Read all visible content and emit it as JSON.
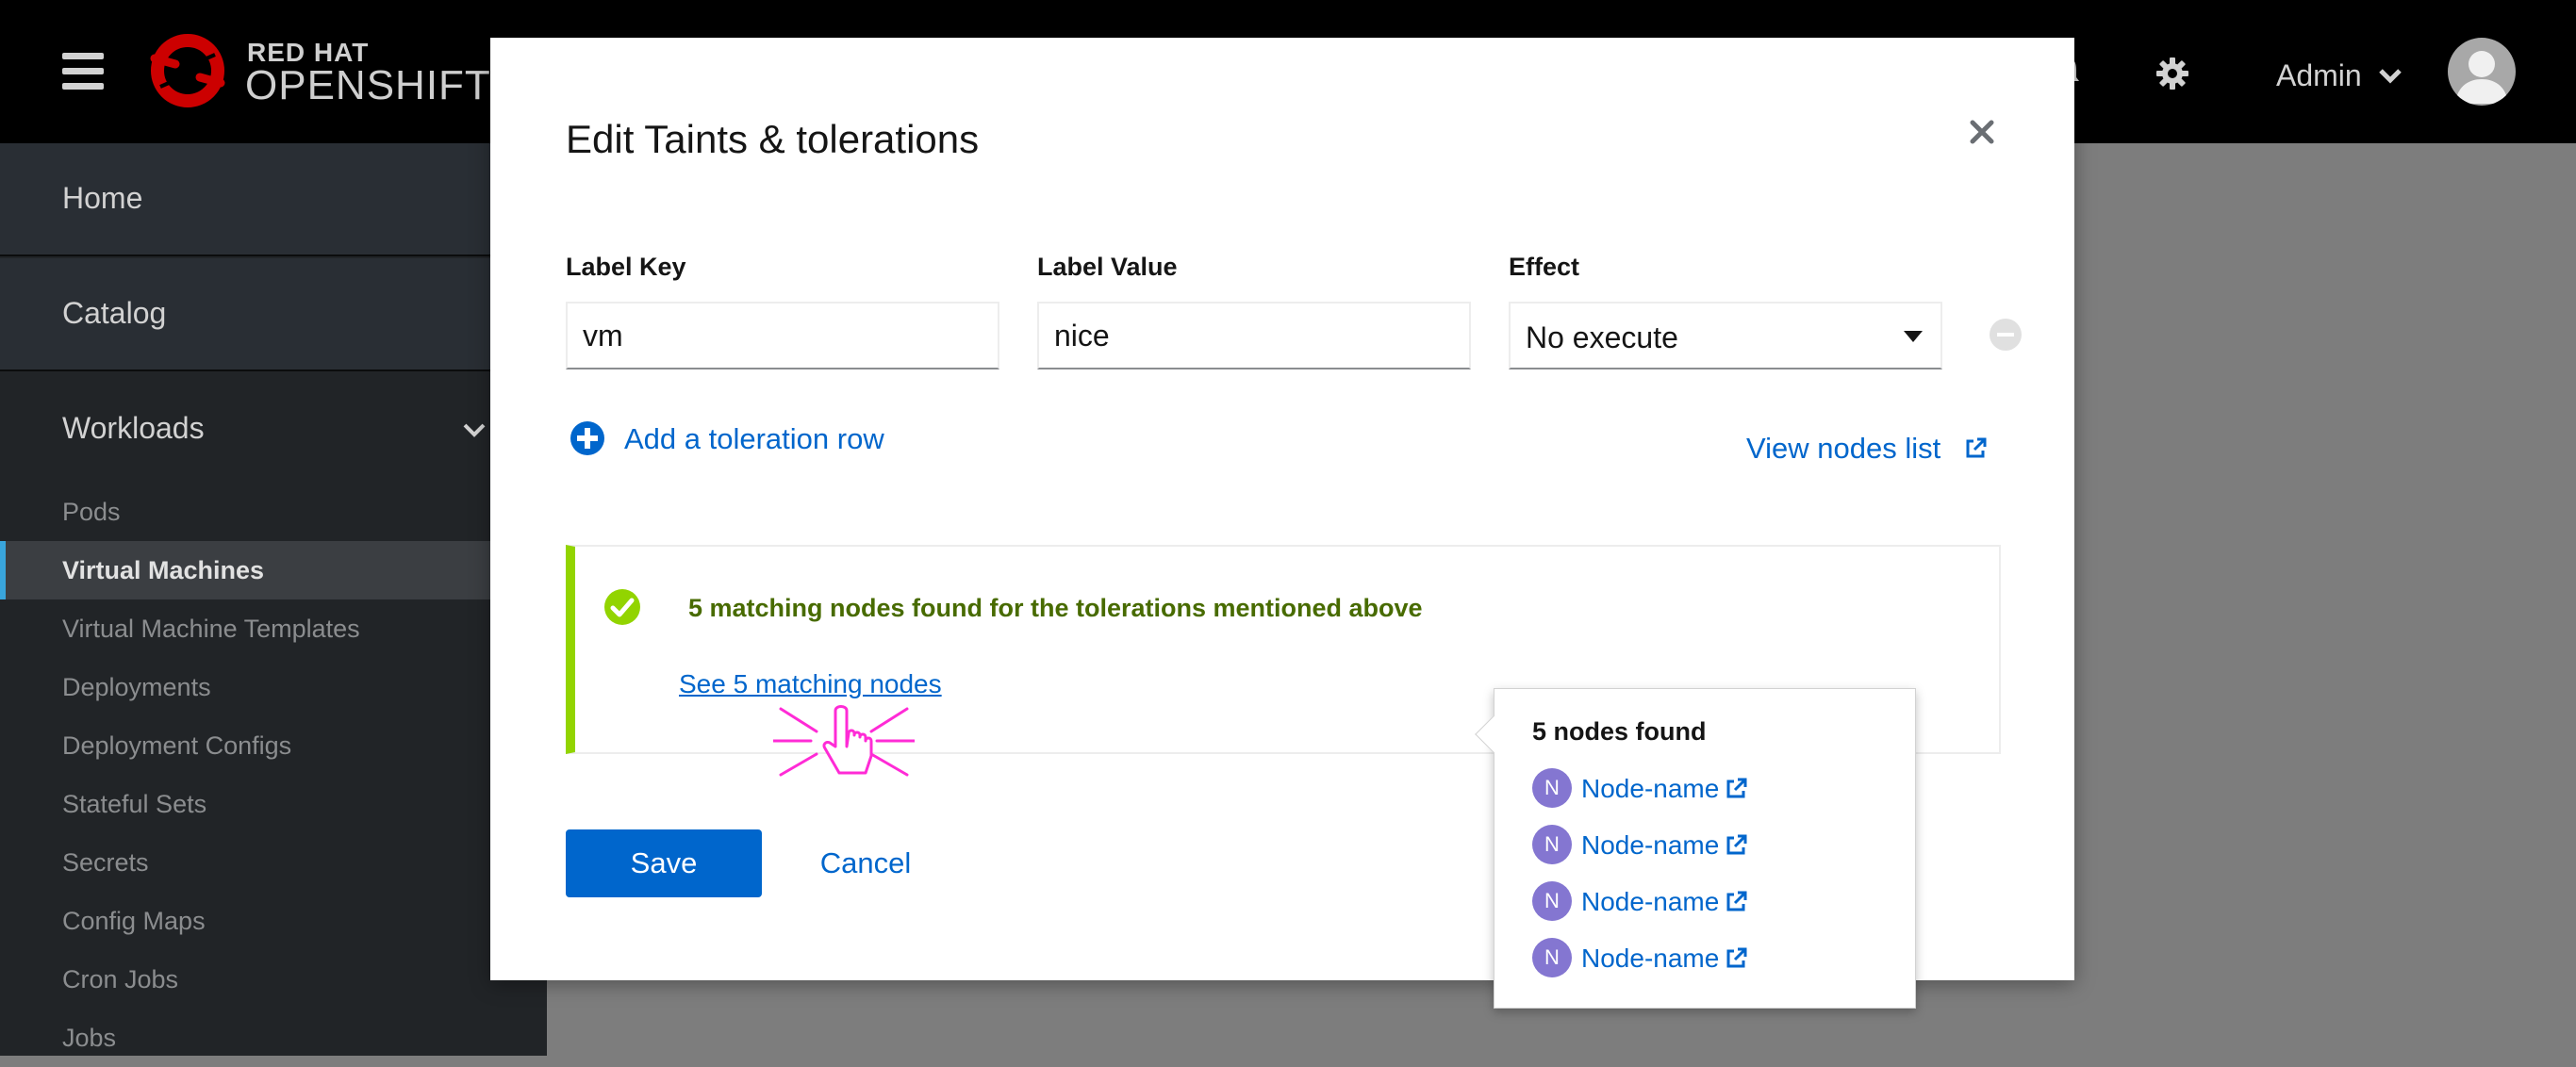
{
  "masthead": {
    "brand_top": "RED HAT",
    "brand_bottom": "OPENSHIFT",
    "user_name": "Admin",
    "icons": [
      "hamburger-icon",
      "bell-icon",
      "gear-icon",
      "chevron-down-icon",
      "avatar-icon"
    ]
  },
  "sidebar": {
    "sections": [
      {
        "label": "Home"
      },
      {
        "label": "Catalog"
      },
      {
        "label": "Workloads"
      }
    ],
    "items": [
      {
        "label": "Pods"
      },
      {
        "label": "Virtual Machines"
      },
      {
        "label": "Virtual Machine Templates"
      },
      {
        "label": "Deployments"
      },
      {
        "label": "Deployment Configs"
      },
      {
        "label": "Stateful Sets"
      },
      {
        "label": "Secrets"
      },
      {
        "label": "Config Maps"
      },
      {
        "label": "Cron Jobs"
      },
      {
        "label": "Jobs"
      }
    ],
    "active_item": "Virtual Machines"
  },
  "modal": {
    "title": "Edit Taints & tolerations",
    "fields": {
      "label_key": {
        "label": "Label Key",
        "value": "vm"
      },
      "label_value": {
        "label": "Label Value",
        "value": "nice"
      },
      "effect": {
        "label": "Effect",
        "value": "No execute"
      }
    },
    "add_row_label": "Add a toleration row",
    "view_nodes_label": "View nodes list",
    "alert": {
      "title": "5 matching nodes found for the tolerations mentioned above",
      "link": "See 5 matching nodes",
      "accent_color": "#92d400"
    },
    "popover": {
      "title": "5 nodes found",
      "nodes": [
        {
          "badge": "N",
          "name": "Node-name"
        },
        {
          "badge": "N",
          "name": "Node-name"
        },
        {
          "badge": "N",
          "name": "Node-name"
        },
        {
          "badge": "N",
          "name": "Node-name"
        }
      ]
    },
    "save_label": "Save",
    "cancel_label": "Cancel"
  },
  "colors": {
    "primary": "#0066cc",
    "success_text": "#486b00",
    "node_badge": "#8476d1"
  }
}
